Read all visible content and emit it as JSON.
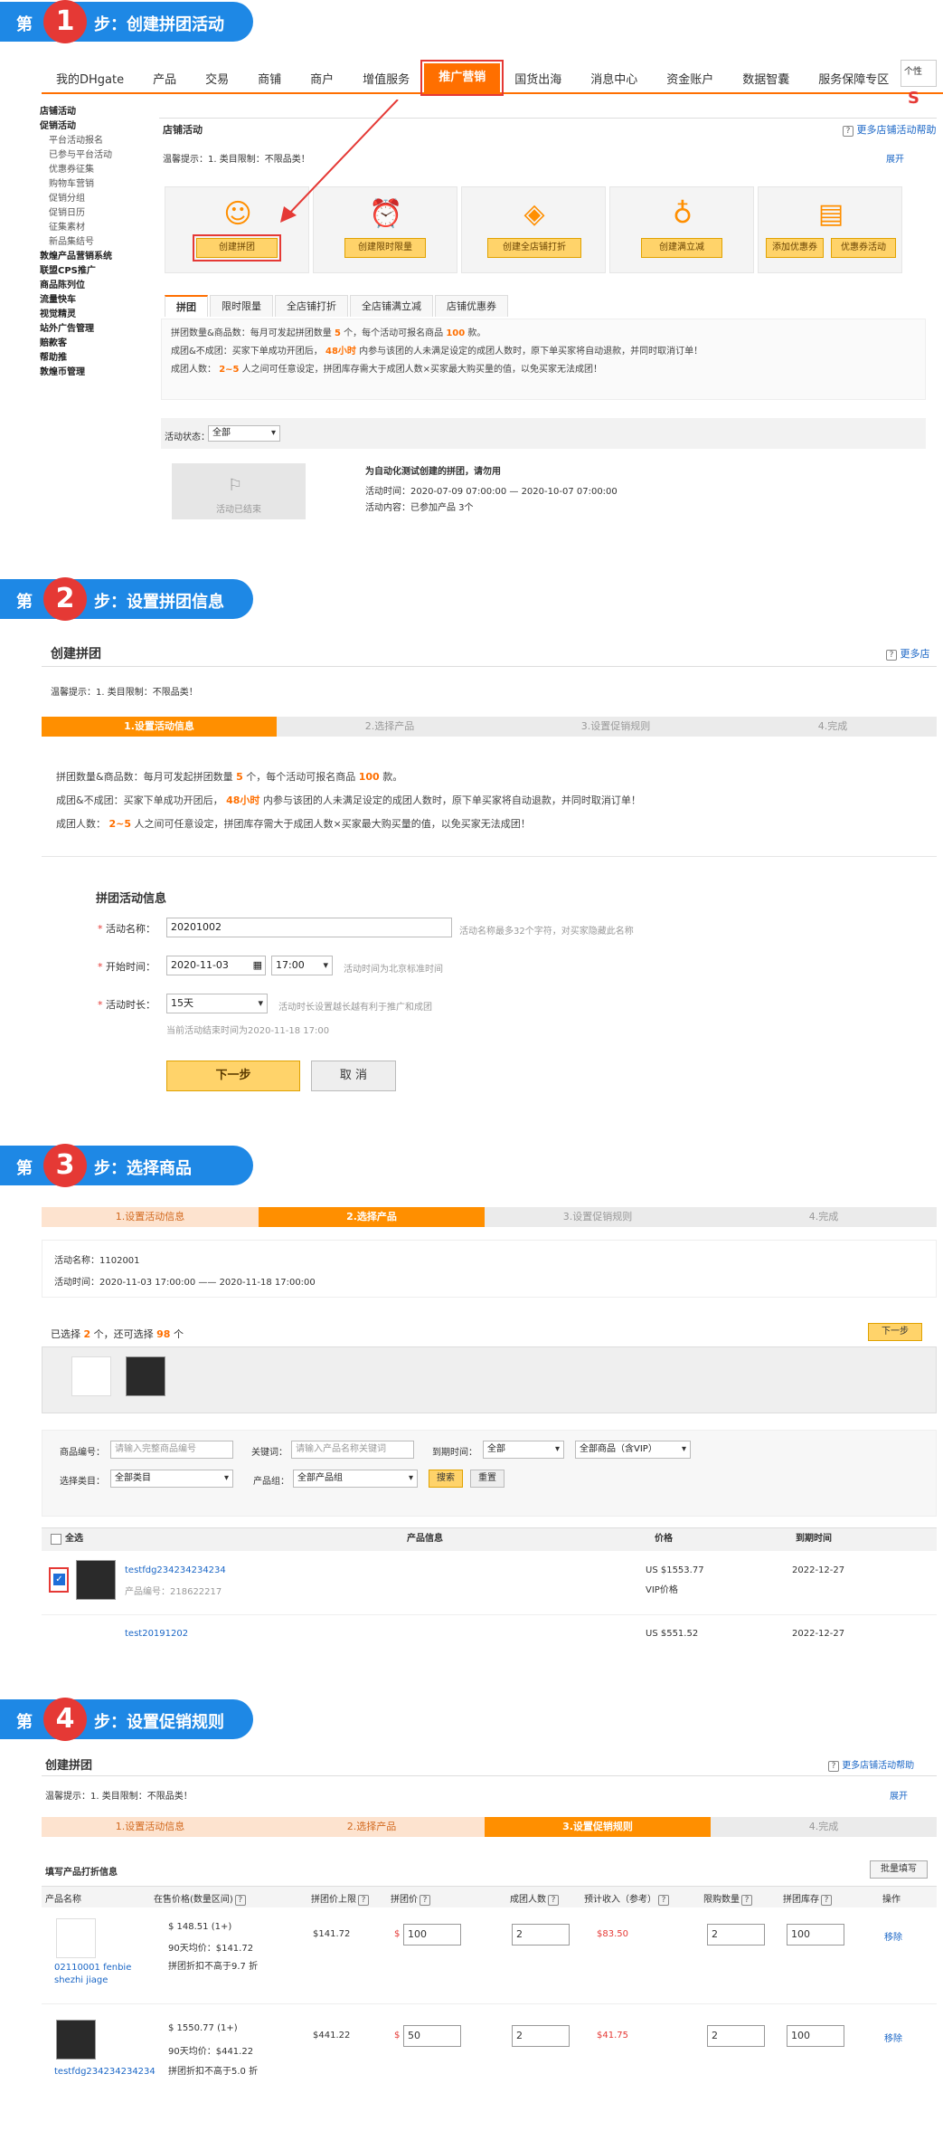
{
  "s1": {
    "banner": {
      "d1": "第",
      "num": "1",
      "d2": "步：创建拼团活动"
    },
    "nav": [
      "我的DHgate",
      "产品",
      "交易",
      "商铺",
      "商户",
      "增值服务",
      "推广营销",
      "国货出海",
      "消息中心",
      "资金账户",
      "数据智囊",
      "服务保障专区"
    ],
    "corner": "个性",
    "side": [
      {
        "t": "店铺活动",
        "h": 1
      },
      {
        "t": "促销活动",
        "h": 1
      },
      {
        "t": "平台活动报名"
      },
      {
        "t": "已参与平台活动"
      },
      {
        "t": "优惠券征集"
      },
      {
        "t": "购物车营销"
      },
      {
        "t": "促销分组"
      },
      {
        "t": "促销日历"
      },
      {
        "t": "征集素材"
      },
      {
        "t": "新品集结号"
      },
      {
        "t": "敦煌产品营销系统",
        "h": 1
      },
      {
        "t": "联盟CPS推广",
        "h": 1
      },
      {
        "t": "商品陈列位",
        "h": 1
      },
      {
        "t": "流量快车",
        "h": 1
      },
      {
        "t": "视觉精灵",
        "h": 1
      },
      {
        "t": "站外广告管理",
        "h": 1
      },
      {
        "t": "赔款客",
        "h": 1
      },
      {
        "t": "帮助推",
        "h": 1
      },
      {
        "t": "敦煌币管理",
        "h": 1
      }
    ],
    "title": "店铺活动",
    "help": "更多店铺活动帮助",
    "tip": "温馨提示：1. 类目限制：不限品类！",
    "expand": "展开",
    "cards": [
      "创建拼团",
      "创建限时限量",
      "创建全店铺打折",
      "创建满立减",
      "添加优惠券",
      "优惠券活动"
    ],
    "tabs": [
      "拼团",
      "限时限量",
      "全店铺打折",
      "全店铺满立减",
      "店铺优惠券"
    ],
    "info": [
      "拼团数量&商品数：每月可发起拼团数量",
      "5",
      "个，每个活动可报名商品",
      "100",
      "款。",
      "成团&不成团：买家下单成功开团后，",
      "48小时",
      "内参与该团的人未满足设定的成团人数时，原下单买家将自动退款，并同时取消订单！",
      "成团人数：",
      "2~5",
      "人之间可任意设定，拼团库存需大于成团人数×买家最大购买量的值，以免买家无法成团！"
    ],
    "status_label": "活动状态：",
    "status_val": "全部",
    "ended": "活动已结束",
    "act_title": "为自动化测试创建的拼团，请勿用",
    "act_time": "活动时间：2020-07-09 07:00:00 — 2020-10-07 07:00:00",
    "act_content": "活动内容：已参加产品 3个"
  },
  "s2": {
    "banner": {
      "d1": "第",
      "num": "2",
      "d2": "步：设置拼团信息"
    },
    "title": "创建拼团",
    "help": "更多店",
    "tip": "温馨提示：1. 类目限制：不限品类！",
    "steps": [
      "1.设置活动信息",
      "2.选择产品",
      "3.设置促销规则",
      "4.完成"
    ],
    "info": [
      "拼团数量&商品数：每月可发起拼团数量",
      "5",
      "个，每个活动可报名商品",
      "100",
      "款。",
      "成团&不成团：买家下单成功开团后，",
      "48小时",
      "内参与该团的人未满足设定的成团人数时，原下单买家将自动退款，并同时取消订单！",
      "成团人数：",
      "2~5",
      "人之间可任意设定，拼团库存需大于成团人数×买家最大购买量的值，以免买家无法成团！"
    ],
    "form_title": "拼团活动信息",
    "name_label": "活动名称：",
    "name_val": "20201002",
    "name_hint": "活动名称最多32个字符，对买家隐藏此名称",
    "start_label": "开始时间：",
    "start_date": "2020-11-03",
    "start_time": "17:00",
    "start_hint": "活动时间为北京标准时间",
    "dur_label": "活动时长：",
    "dur_val": "15天",
    "dur_hint": "活动时长设置越长越有利于推广和成团",
    "end_note": "当前活动结束时间为2020-11-18 17:00",
    "next": "下一步",
    "cancel": "取 消"
  },
  "s3": {
    "banner": {
      "d1": "第",
      "num": "3",
      "d2": "步：选择商品"
    },
    "steps": [
      "1.设置活动信息",
      "2.选择产品",
      "3.设置促销规则",
      "4.完成"
    ],
    "act_name": "活动名称：1102001",
    "act_time": "活动时间：2020-11-03 17:00:00 —— 2020-11-18 17:00:00",
    "sel_a": "已选择",
    "sel_n": "2",
    "sel_b": "个，还可选择",
    "sel_m": "98",
    "sel_c": "个",
    "next": "下一步",
    "f_code": "商品编号：",
    "f_code_ph": "请输入完整商品编号",
    "f_kw": "关键词：",
    "f_kw_ph": "请输入产品名称关键词",
    "f_exp": "到期时间：",
    "f_exp_val": "全部",
    "f_type_val": "全部商品（含VIP）",
    "f_cat": "选择类目：",
    "f_cat_val": "全部类目",
    "f_grp": "产品组：",
    "f_grp_val": "全部产品组",
    "search": "搜索",
    "reset": "重置",
    "cols": [
      "全选",
      "产品信息",
      "价格",
      "到期时间"
    ],
    "row1": {
      "name": "testfdg234234234234",
      "code": "产品编号：218622217",
      "price": "US $1553.77",
      "vip": "VIP价格",
      "exp": "2022-12-27"
    },
    "row2": {
      "name": "test20191202",
      "price": "US $551.52",
      "exp": "2022-12-27"
    }
  },
  "s4": {
    "banner": {
      "d1": "第",
      "num": "4",
      "d2": "步：设置促销规则"
    },
    "title": "创建拼团",
    "help": "更多店铺活动帮助",
    "tip": "温馨提示：1. 类目限制：不限品类！",
    "expand": "展开",
    "steps": [
      "1.设置活动信息",
      "2.选择产品",
      "3.设置促销规则",
      "4.完成"
    ],
    "section": "填写产品打折信息",
    "batch": "批量填写",
    "cols": [
      "产品名称",
      "在售价格(数量区间)",
      "拼团价上限",
      "拼团价",
      "成团人数",
      "预计收入（参考）",
      "限购数量",
      "拼团库存",
      "操作"
    ],
    "rows": [
      {
        "name": "02110001 fenbie shezhi jiage",
        "p1": "$ 148.51 (1+)",
        "p2": "90天均价：$141.72",
        "p3": "拼团折扣不高于9.7 折",
        "cap": "$141.72",
        "cur": "$",
        "price": "100",
        "group": "2",
        "income": "$83.50",
        "limit": "2",
        "stock": "100",
        "op": "移除"
      },
      {
        "name": "testfdg234234234234",
        "p1": "$ 1550.77 (1+)",
        "p2": "90天均价：$441.22",
        "p3": "拼团折扣不高于5.0 折",
        "cap": "$441.22",
        "cur": "$",
        "price": "50",
        "group": "2",
        "income": "$41.75",
        "limit": "2",
        "stock": "100",
        "op": "移除"
      }
    ]
  }
}
